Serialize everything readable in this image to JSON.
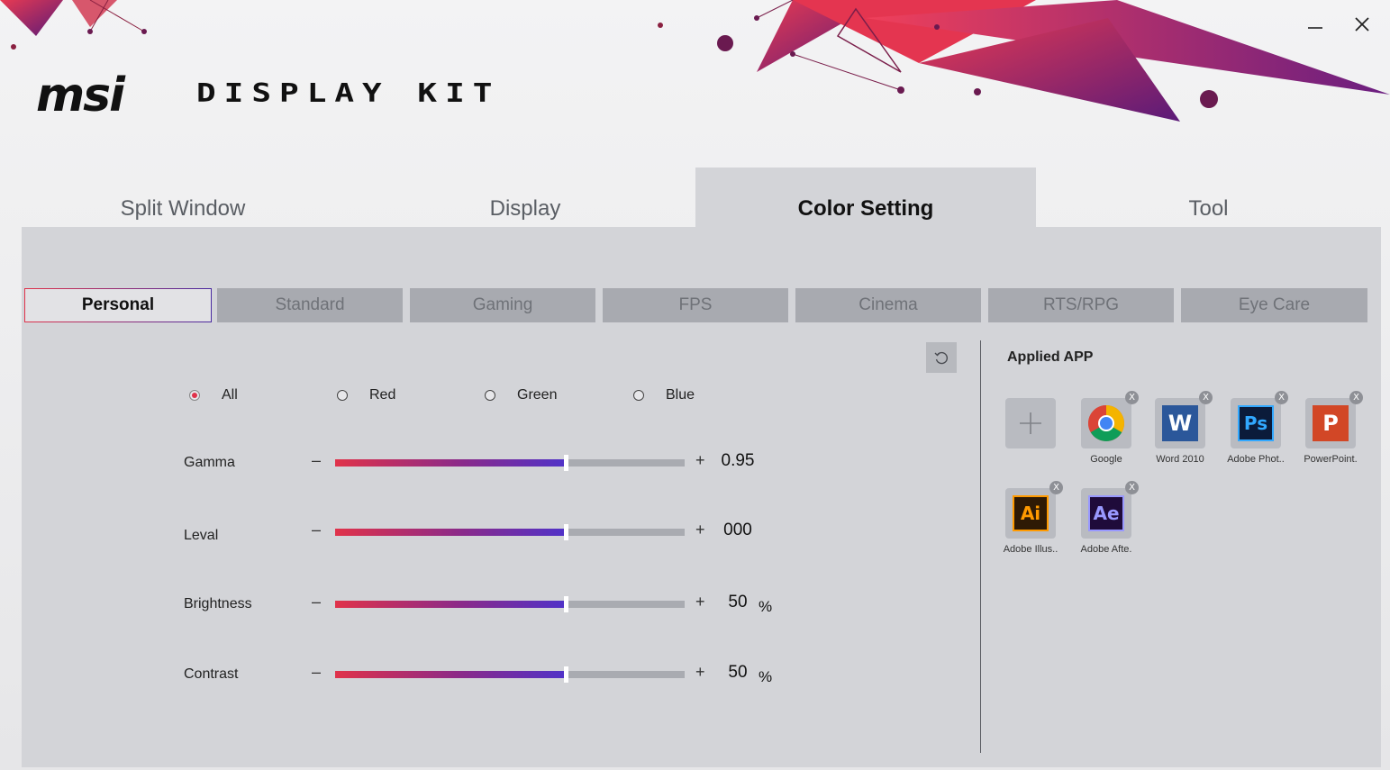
{
  "header": {
    "brand": "msi",
    "product": "DISPLAY KIT",
    "minimize_icon": "minimize-icon",
    "close_icon": "close-icon"
  },
  "tabs": [
    {
      "label": "Split Window"
    },
    {
      "label": "Display"
    },
    {
      "label": "Color Setting",
      "active": true
    },
    {
      "label": "Tool"
    }
  ],
  "modes": [
    {
      "label": "Personal",
      "active": true
    },
    {
      "label": "Standard"
    },
    {
      "label": "Gaming"
    },
    {
      "label": "FPS"
    },
    {
      "label": "Cinema"
    },
    {
      "label": "RTS/RPG"
    },
    {
      "label": "Eye Care"
    }
  ],
  "reset_icon": "reset-icon",
  "channels": [
    {
      "label": "All",
      "selected": true
    },
    {
      "label": "Red"
    },
    {
      "label": "Green"
    },
    {
      "label": "Blue"
    }
  ],
  "sliders": [
    {
      "label": "Gamma",
      "value": "0.95",
      "unit": "",
      "level": 0.66
    },
    {
      "label": "Leval",
      "value": "000",
      "unit": "",
      "level": 0.66
    },
    {
      "label": "Brightness",
      "value": "50",
      "unit": "%",
      "level": 0.66
    },
    {
      "label": "Contrast",
      "value": "50",
      "unit": "%",
      "level": 0.66
    }
  ],
  "slider_symbols": {
    "minus": "–",
    "plus": "+"
  },
  "applied": {
    "title": "Applied APP",
    "add_icon": "plus-icon",
    "remove_label": "X",
    "apps": [
      {
        "name": "Google",
        "icon": "chrome-icon"
      },
      {
        "name": "Word 2010",
        "icon": "word-icon",
        "glyph": "W"
      },
      {
        "name": "Adobe Phot..",
        "icon": "photoshop-icon",
        "glyph": "Ps"
      },
      {
        "name": "PowerPoint.",
        "icon": "powerpoint-icon",
        "glyph": "P"
      },
      {
        "name": "Adobe Illus..",
        "icon": "illustrator-icon",
        "glyph": "Ai"
      },
      {
        "name": "Adobe Afte.",
        "icon": "aftereffects-icon",
        "glyph": "Ae"
      }
    ]
  },
  "colors": {
    "accent_red": "#e0324a",
    "accent_purple": "#5032c8",
    "panel": "#d3d4d8"
  }
}
